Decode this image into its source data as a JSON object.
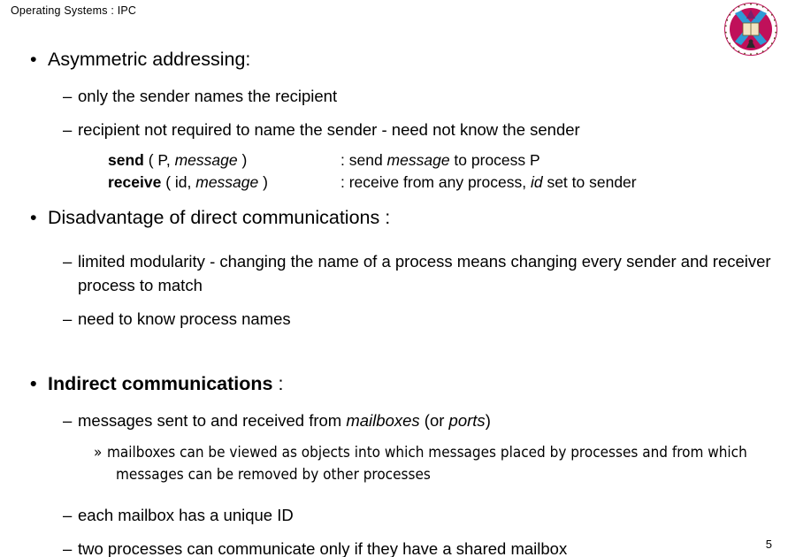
{
  "slide": {
    "title": "Operating Systems : IPC",
    "page_number": "5",
    "logo_name": "university-of-edinburgh-crest",
    "colors": {
      "crest_ring": "#C0105A",
      "crest_saltire": "#2E9BD6",
      "crest_book": "#F2E3C0",
      "text": "#000000",
      "background": "#FFFFFF"
    },
    "markers": {
      "level1": "•",
      "level2": "–",
      "level3": "»"
    }
  },
  "bullets": {
    "b1_heading": "Asymmetric addressing:",
    "b1_sub1": "only the sender names the recipient",
    "b1_sub2": "recipient not required to name the sender - need not know the sender",
    "b2_heading": "Disadvantage of direct communications :",
    "b2_sub1": "limited modularity - changing the name of a process means changing every sender and receiver process to match",
    "b2_sub2": "need to know process names",
    "b3_heading_strong": "Indirect communications",
    "b3_heading_tail": " :",
    "b3_sub1_pre": "messages sent to and received from ",
    "b3_sub1_em1": "mailboxes",
    "b3_sub1_mid": " (or ",
    "b3_sub1_em2": "ports",
    "b3_sub1_post": ")",
    "b3_sub1_sub1": "mailboxes can be viewed as objects into which messages placed by processes and from which messages can be removed by other processes",
    "b3_sub2": "each mailbox has a unique ID",
    "b3_sub3": "two processes can communicate only if they have a shared mailbox"
  },
  "signatures": [
    {
      "keyword": "send",
      "open": " ( P, ",
      "param_em": "message",
      "close": " )",
      "desc_pre": ": send ",
      "desc_em": "message",
      "desc_post": " to process P"
    },
    {
      "keyword": "receive",
      "open": " ( id, ",
      "param_em": "message",
      "close": " )",
      "desc_pre": ": receive from any process, ",
      "desc_em": "id",
      "desc_post": " set to sender"
    }
  ]
}
